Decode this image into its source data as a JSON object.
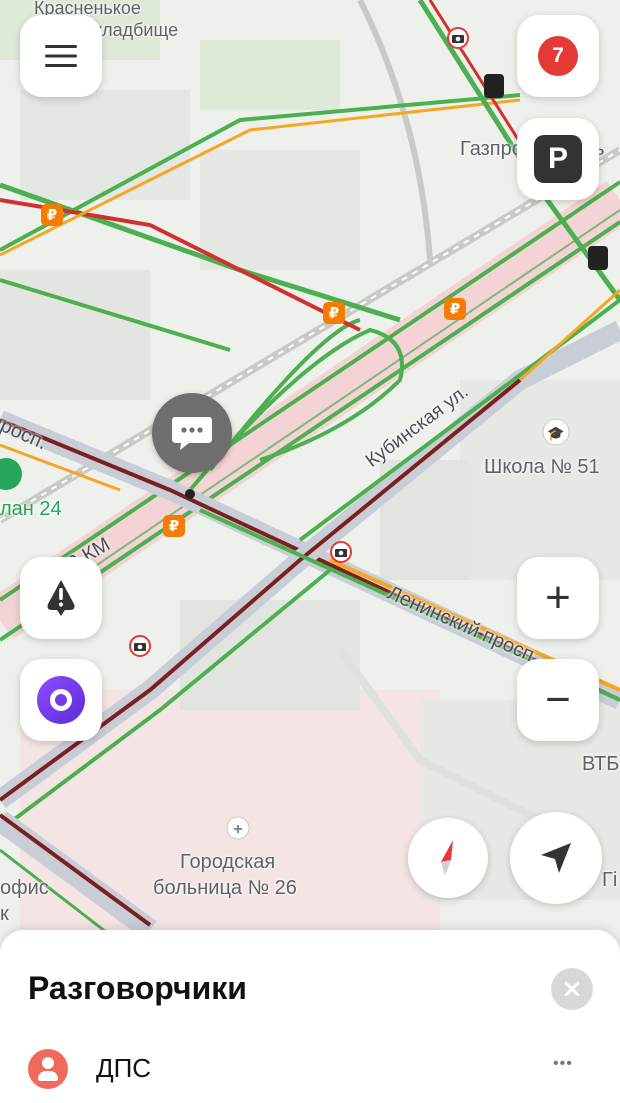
{
  "map": {
    "labels": {
      "cemetery": "Красненькое",
      "cemetery2": "кладбище",
      "gazprom": "Газпро",
      "gazprom2": "ть",
      "school": "Школа № 51",
      "hospital1": "Городская",
      "hospital2": "больница № 26",
      "kubinskaya": "Кубинская ул.",
      "leninsky": "Ленинский просп.",
      "prosp_left": "просп.",
      "km": "2 КМ",
      "plan": "лан 24",
      "vtb": "ВТБ",
      "ofis": "офис",
      "k": "к",
      "gi": "Гі"
    },
    "colors": {
      "green": "#4caf50",
      "red": "#d32f2f",
      "dark_red": "#7b1f1f",
      "orange": "#f5a623",
      "road_pink": "#f3d3d3"
    }
  },
  "controls": {
    "menu_icon": "hamburger-icon",
    "notifications_count": "7",
    "parking_label": "P",
    "zoom_in": "+",
    "zoom_out": "−",
    "alert_icon": "warning-icon",
    "alice_icon": "alice-icon",
    "compass_icon": "compass-icon",
    "locate_icon": "navigation-arrow-icon",
    "chat_icon": "chat-bubble-icon"
  },
  "sheet": {
    "title": "Разговорчики",
    "close_icon": "close-icon",
    "item_label": "ДПС",
    "item_more": "•••"
  }
}
